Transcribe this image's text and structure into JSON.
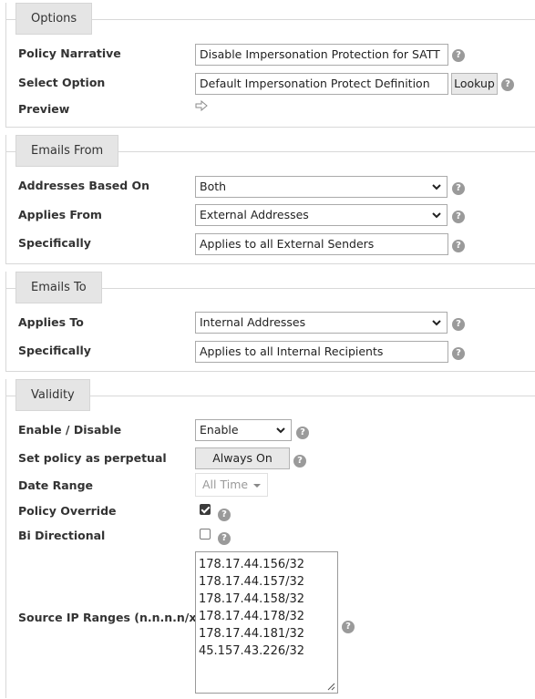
{
  "options": {
    "tab": "Options",
    "policy_narrative_label": "Policy Narrative",
    "policy_narrative_value": "Disable Impersonation Protection for SATT",
    "select_option_label": "Select Option",
    "select_option_value": "Default Impersonation Protect Definition",
    "lookup_button": "Lookup",
    "preview_label": "Preview"
  },
  "emails_from": {
    "tab": "Emails From",
    "addresses_based_on_label": "Addresses Based On",
    "addresses_based_on_value": "Both",
    "applies_from_label": "Applies From",
    "applies_from_value": "External Addresses",
    "specifically_label": "Specifically",
    "specifically_value": "Applies to all External Senders"
  },
  "emails_to": {
    "tab": "Emails To",
    "applies_to_label": "Applies To",
    "applies_to_value": "Internal Addresses",
    "specifically_label": "Specifically",
    "specifically_value": "Applies to all Internal Recipients"
  },
  "validity": {
    "tab": "Validity",
    "enable_disable_label": "Enable / Disable",
    "enable_disable_value": "Enable",
    "perpetual_label": "Set policy as perpetual",
    "perpetual_button": "Always On",
    "date_range_label": "Date Range",
    "date_range_value": "All Time",
    "policy_override_label": "Policy Override",
    "policy_override_checked": true,
    "bi_directional_label": "Bi Directional",
    "bi_directional_checked": false,
    "source_ip_label": "Source IP Ranges (n.n.n.n/x)",
    "source_ips": [
      "178.17.44.156/32",
      "178.17.44.157/32",
      "178.17.44.158/32",
      "178.17.44.178/32",
      "178.17.44.181/32",
      "45.157.43.226/32"
    ]
  },
  "help_glyph": "?",
  "icons": {
    "help": "help-icon",
    "preview": "arrow-right-icon",
    "dropdown": "chevron-down-icon",
    "resize": "resize-handle-icon"
  }
}
